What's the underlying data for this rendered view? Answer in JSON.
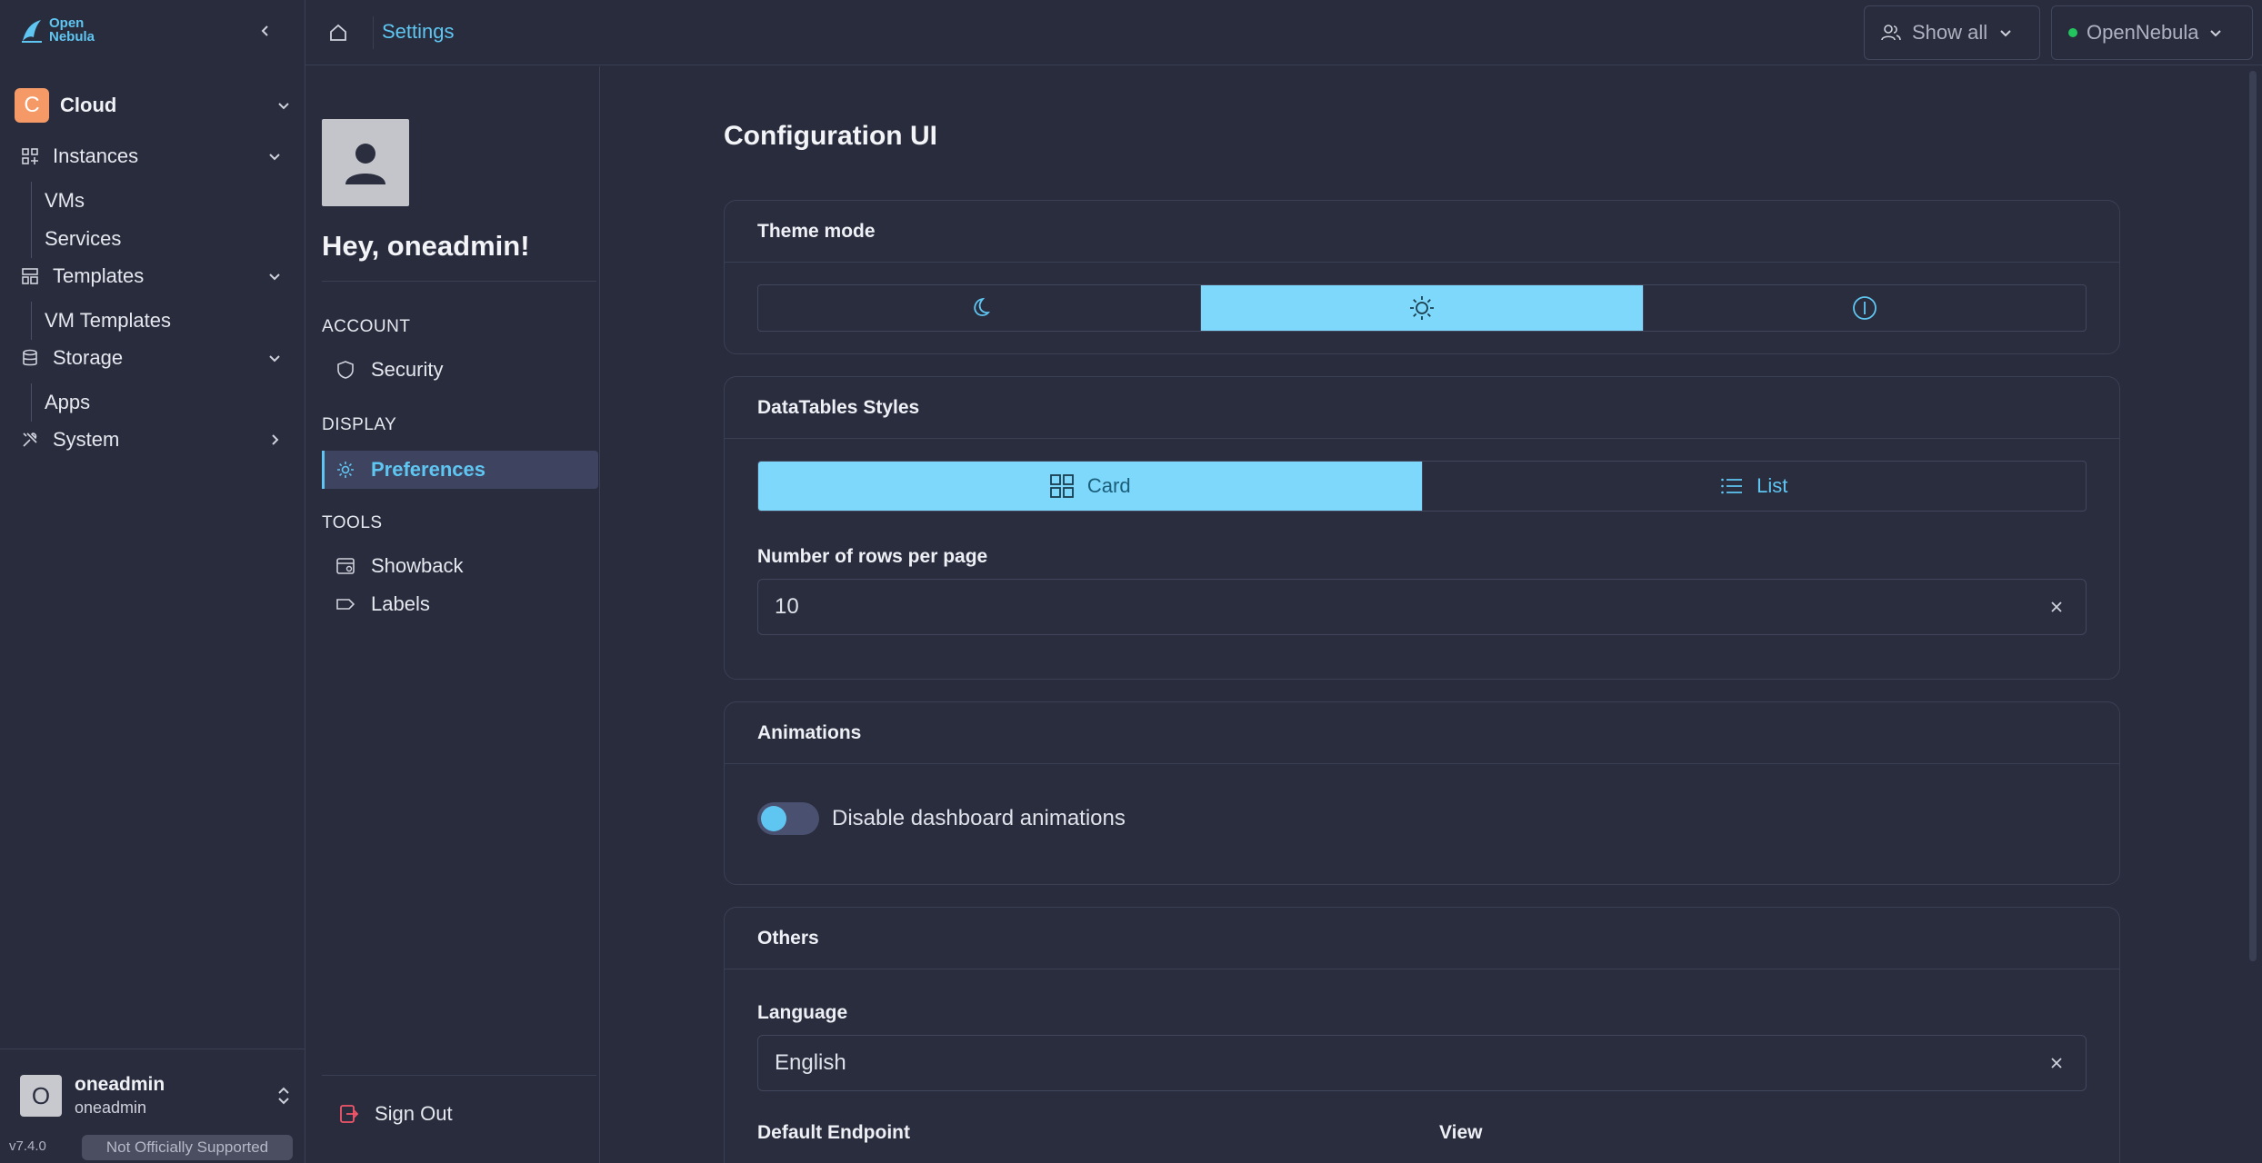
{
  "app": {
    "logo_line1": "Open",
    "logo_line2": "Nebula"
  },
  "sidebar": {
    "cloud": {
      "initial": "C",
      "label": "Cloud"
    },
    "groups": [
      {
        "label": "Instances",
        "icon": "grid-icon",
        "items": [
          "VMs",
          "Services"
        ]
      },
      {
        "label": "Templates",
        "icon": "templates-icon",
        "items": [
          "VM Templates"
        ]
      },
      {
        "label": "Storage",
        "icon": "database-icon",
        "items": [
          "Apps"
        ]
      },
      {
        "label": "System",
        "icon": "tools-icon",
        "items": []
      }
    ],
    "user": {
      "initial": "O",
      "name": "oneadmin",
      "group": "oneadmin"
    },
    "version": "v7.4.0",
    "support_badge": "Not Officially Supported"
  },
  "topbar": {
    "breadcrumb": "Settings",
    "show_all": "Show all",
    "zone": "OpenNebula",
    "zone_status_color": "#22c55e"
  },
  "settings_menu": {
    "greeting": "Hey, oneadmin!",
    "sections": [
      {
        "title": "ACCOUNT",
        "items": [
          {
            "label": "Security",
            "icon": "shield-icon"
          }
        ]
      },
      {
        "title": "DISPLAY",
        "items": [
          {
            "label": "Preferences",
            "icon": "gear-icon",
            "active": true
          }
        ]
      },
      {
        "title": "TOOLS",
        "items": [
          {
            "label": "Showback",
            "icon": "calendar-icon"
          },
          {
            "label": "Labels",
            "icon": "label-icon"
          }
        ]
      }
    ],
    "sign_out": "Sign Out"
  },
  "main": {
    "title": "Configuration UI",
    "theme": {
      "heading": "Theme mode",
      "options": [
        {
          "icon": "moon-icon",
          "selected": false
        },
        {
          "icon": "sun-icon",
          "selected": true
        },
        {
          "icon": "system-icon",
          "selected": false
        }
      ]
    },
    "datatables": {
      "heading": "DataTables Styles",
      "options": [
        {
          "label": "Card",
          "icon": "card-grid-icon",
          "selected": true
        },
        {
          "label": "List",
          "icon": "list-icon",
          "selected": false
        }
      ],
      "rows_label": "Number of rows per page",
      "rows_value": "10"
    },
    "animations": {
      "heading": "Animations",
      "toggle_label": "Disable dashboard animations",
      "toggle_on": false
    },
    "others": {
      "heading": "Others",
      "language_label": "Language",
      "language_value": "English",
      "endpoint_label": "Default Endpoint",
      "view_label": "View"
    }
  },
  "colors": {
    "accent": "#5fc6f2",
    "selected_bg": "#7dd8fb",
    "background": "#292c3d"
  }
}
